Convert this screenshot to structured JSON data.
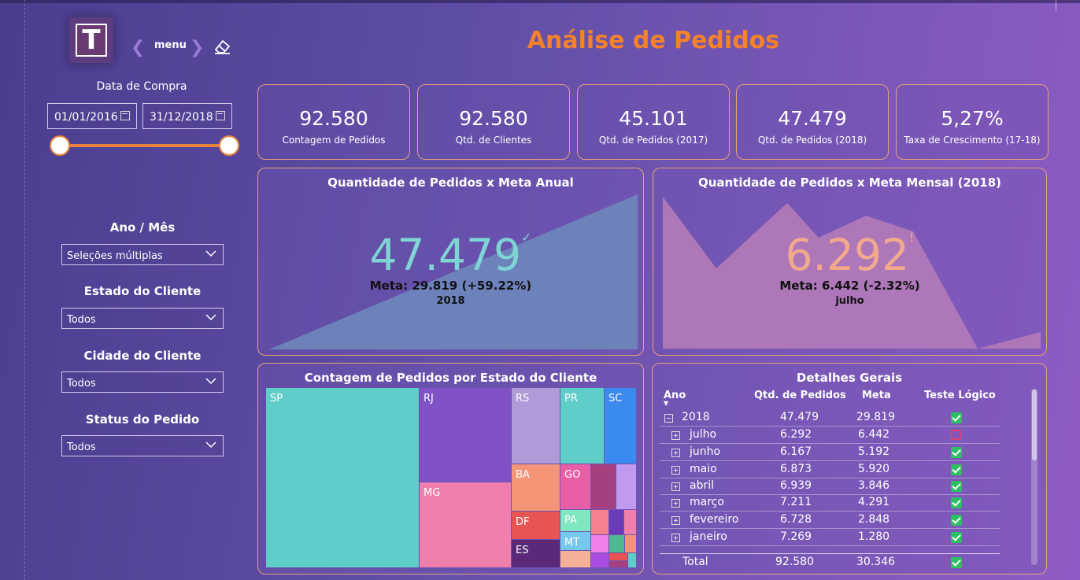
{
  "header": {
    "title": "Análise de Pedidos",
    "logo_letter": "T",
    "nav_label": "menu"
  },
  "date_filter": {
    "title": "Data de Compra",
    "start": "01/01/2016",
    "end": "31/12/2018"
  },
  "filters": [
    {
      "title": "Ano / Mês",
      "value": "Seleções múltiplas"
    },
    {
      "title": "Estado do Cliente",
      "value": "Todos"
    },
    {
      "title": "Cidade do Cliente",
      "value": "Todos"
    },
    {
      "title": "Status do Pedido",
      "value": "Todos"
    }
  ],
  "kpis": [
    {
      "value": "92.580",
      "label": "Contagem de Pedidos"
    },
    {
      "value": "92.580",
      "label": "Qtd. de Clientes"
    },
    {
      "value": "45.101",
      "label": "Qtd. de Pedidos (2017)"
    },
    {
      "value": "47.479",
      "label": "Qtd. de Pedidos (2018)"
    },
    {
      "value": "5,27%",
      "label": "Taxa de Crescimento (17-18)"
    }
  ],
  "annual_goal": {
    "title": "Quantidade de Pedidos x Meta Anual",
    "value": "47.479",
    "status_glyph": "✓",
    "meta": "Meta: 29.819 (+59.22%)",
    "period": "2018"
  },
  "monthly_goal": {
    "title": "Quantidade de Pedidos x Meta Mensal (2018)",
    "value": "6.292",
    "status_glyph": "!",
    "meta": "Meta: 6.442 (-2.32%)",
    "period": "julho"
  },
  "treemap": {
    "title": "Contagem de Pedidos por Estado do Cliente",
    "labels": [
      "SP",
      "RJ",
      "RS",
      "PR",
      "SC",
      "MG",
      "BA",
      "GO",
      "DF",
      "PA",
      "ES",
      "MT"
    ]
  },
  "details": {
    "title": "Detalhes Gerais",
    "columns": [
      "Ano",
      "Qtd. de Pedidos",
      "Meta",
      "Teste Lógico"
    ],
    "rows": [
      {
        "label": "2018",
        "qty": "47.479",
        "meta": "29.819",
        "ok": true,
        "level": 0
      },
      {
        "label": "julho",
        "qty": "6.292",
        "meta": "6.442",
        "ok": false,
        "level": 1
      },
      {
        "label": "junho",
        "qty": "6.167",
        "meta": "5.192",
        "ok": true,
        "level": 1
      },
      {
        "label": "maio",
        "qty": "6.873",
        "meta": "5.920",
        "ok": true,
        "level": 1
      },
      {
        "label": "abril",
        "qty": "6.939",
        "meta": "3.846",
        "ok": true,
        "level": 1
      },
      {
        "label": "março",
        "qty": "7.211",
        "meta": "4.291",
        "ok": true,
        "level": 1
      },
      {
        "label": "fevereiro",
        "qty": "6.728",
        "meta": "2.848",
        "ok": true,
        "level": 1
      },
      {
        "label": "janeiro",
        "qty": "7.269",
        "meta": "1.280",
        "ok": true,
        "level": 1
      }
    ],
    "total": {
      "label": "Total",
      "qty": "92.580",
      "meta": "30.346",
      "ok": true
    }
  },
  "colors": {
    "accent": "#f4822a",
    "annual_value": "#7fd4d4",
    "monthly_value": "#f2a98c",
    "ok": "#2bc063",
    "fail": "#e04070"
  }
}
